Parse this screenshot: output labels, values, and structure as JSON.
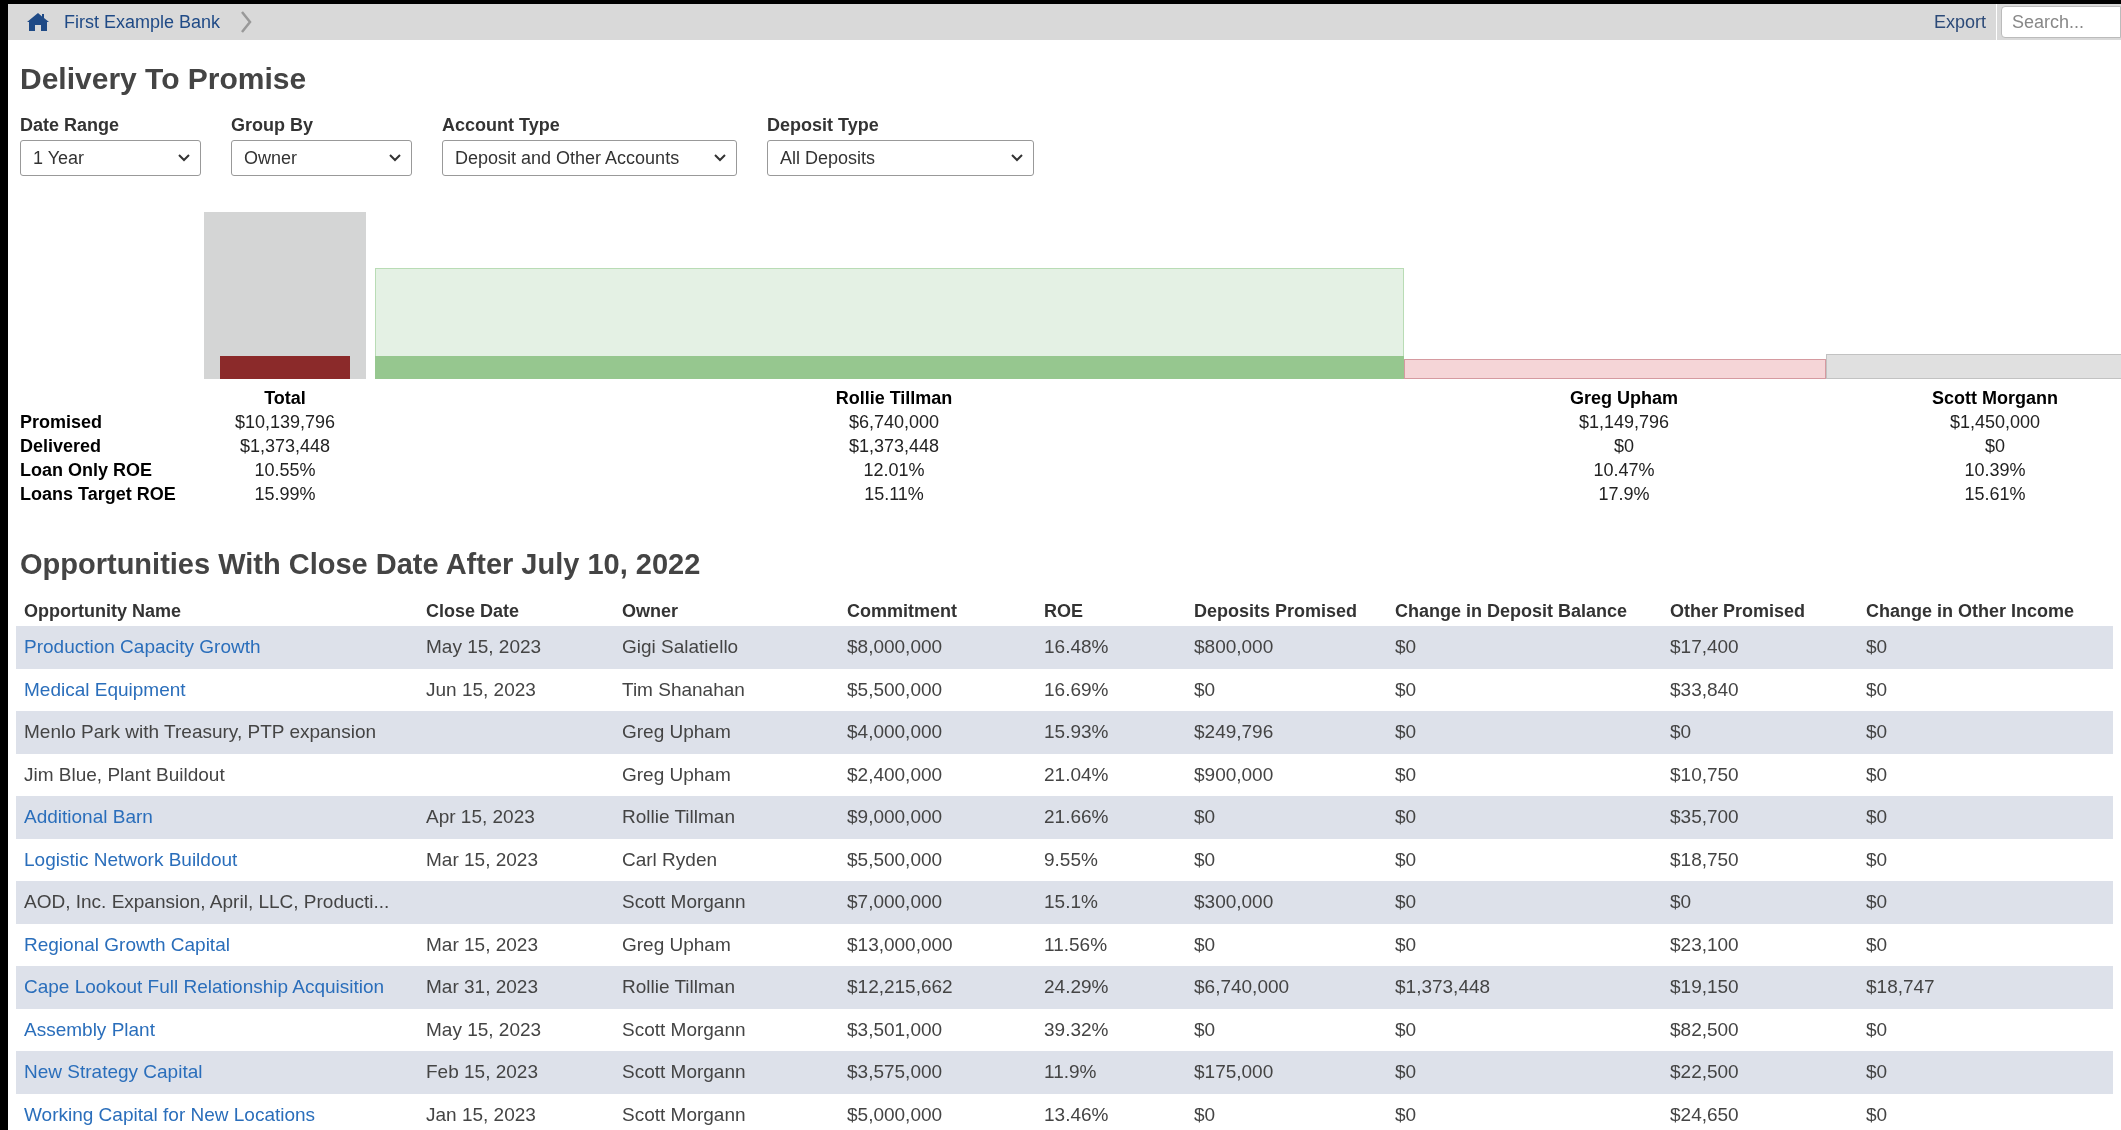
{
  "breadcrumb": {
    "items": [
      "First Example Bank"
    ]
  },
  "toolbar": {
    "export": "Export",
    "search": {
      "placeholder": "Search..."
    }
  },
  "title": "Delivery To Promise",
  "filters": [
    {
      "label": "Date Range",
      "value": "1 Year"
    },
    {
      "label": "Group By",
      "value": "Owner"
    },
    {
      "label": "Account Type",
      "value": "Deposit and Other Accounts"
    },
    {
      "label": "Deposit Type",
      "value": "All Deposits"
    }
  ],
  "summary": {
    "row_labels": [
      "Promised",
      "Delivered",
      "Loan Only ROE",
      "Loans Target ROE"
    ],
    "groups": [
      {
        "name": "Total",
        "color": "#8b2a2a",
        "values": [
          "$10,139,796",
          "$1,373,448",
          "10.55%",
          "15.99%"
        ]
      },
      {
        "name": "Rollie Tillman",
        "color": "#96c78f",
        "values": [
          "$6,740,000",
          "$1,373,448",
          "12.01%",
          "15.11%"
        ]
      },
      {
        "name": "Greg Upham",
        "color": "#f5d5d7",
        "values": [
          "$1,149,796",
          "$0",
          "10.47%",
          "17.9%"
        ]
      },
      {
        "name": "Scott Morgann",
        "color": "#e0e0e0",
        "values": [
          "$1,450,000",
          "$0",
          "10.39%",
          "15.61%"
        ]
      }
    ]
  },
  "table": {
    "title": "Opportunities With Close Date After July 10, 2022",
    "columns": [
      "Opportunity Name",
      "Close Date",
      "Owner",
      "Commitment",
      "ROE",
      "Deposits Promised",
      "Change in Deposit Balance",
      "Other Promised",
      "Change in Other Income"
    ],
    "rows": [
      {
        "link": true,
        "cells": [
          "Production Capacity Growth",
          "May 15, 2023",
          "Gigi Salatiello",
          "$8,000,000",
          "16.48%",
          "$800,000",
          "$0",
          "$17,400",
          "$0"
        ]
      },
      {
        "link": true,
        "cells": [
          "Medical Equipment",
          "Jun 15, 2023",
          "Tim Shanahan",
          "$5,500,000",
          "16.69%",
          "$0",
          "$0",
          "$33,840",
          "$0"
        ]
      },
      {
        "link": false,
        "cells": [
          "Menlo Park with Treasury, PTP expansion",
          "",
          "Greg Upham",
          "$4,000,000",
          "15.93%",
          "$249,796",
          "$0",
          "$0",
          "$0"
        ]
      },
      {
        "link": false,
        "cells": [
          "Jim Blue, Plant Buildout",
          "",
          "Greg Upham",
          "$2,400,000",
          "21.04%",
          "$900,000",
          "$0",
          "$10,750",
          "$0"
        ]
      },
      {
        "link": true,
        "cells": [
          "Additional Barn",
          "Apr 15, 2023",
          "Rollie Tillman",
          "$9,000,000",
          "21.66%",
          "$0",
          "$0",
          "$35,700",
          "$0"
        ]
      },
      {
        "link": true,
        "cells": [
          "Logistic Network Buildout",
          "Mar 15, 2023",
          "Carl Ryden",
          "$5,500,000",
          "9.55%",
          "$0",
          "$0",
          "$18,750",
          "$0"
        ]
      },
      {
        "link": false,
        "cells": [
          "AOD, Inc. Expansion, April, LLC, Producti...",
          "",
          "Scott Morgann",
          "$7,000,000",
          "15.1%",
          "$300,000",
          "$0",
          "$0",
          "$0"
        ]
      },
      {
        "link": true,
        "cells": [
          "Regional Growth Capital",
          "Mar 15, 2023",
          "Greg Upham",
          "$13,000,000",
          "11.56%",
          "$0",
          "$0",
          "$23,100",
          "$0"
        ]
      },
      {
        "link": true,
        "cells": [
          "Cape Lookout Full Relationship Acquisition",
          "Mar 31, 2023",
          "Rollie Tillman",
          "$12,215,662",
          "24.29%",
          "$6,740,000",
          "$1,373,448",
          "$19,150",
          "$18,747"
        ]
      },
      {
        "link": true,
        "cells": [
          "Assembly Plant",
          "May 15, 2023",
          "Scott Morgann",
          "$3,501,000",
          "39.32%",
          "$0",
          "$0",
          "$82,500",
          "$0"
        ]
      },
      {
        "link": true,
        "cells": [
          "New Strategy Capital",
          "Feb 15, 2023",
          "Scott Morgann",
          "$3,575,000",
          "11.9%",
          "$175,000",
          "$0",
          "$22,500",
          "$0"
        ]
      },
      {
        "link": true,
        "cells": [
          "Working Capital for New Locations",
          "Jan 15, 2023",
          "Scott Morgann",
          "$5,000,000",
          "13.46%",
          "$0",
          "$0",
          "$24,650",
          "$0"
        ]
      }
    ]
  }
}
